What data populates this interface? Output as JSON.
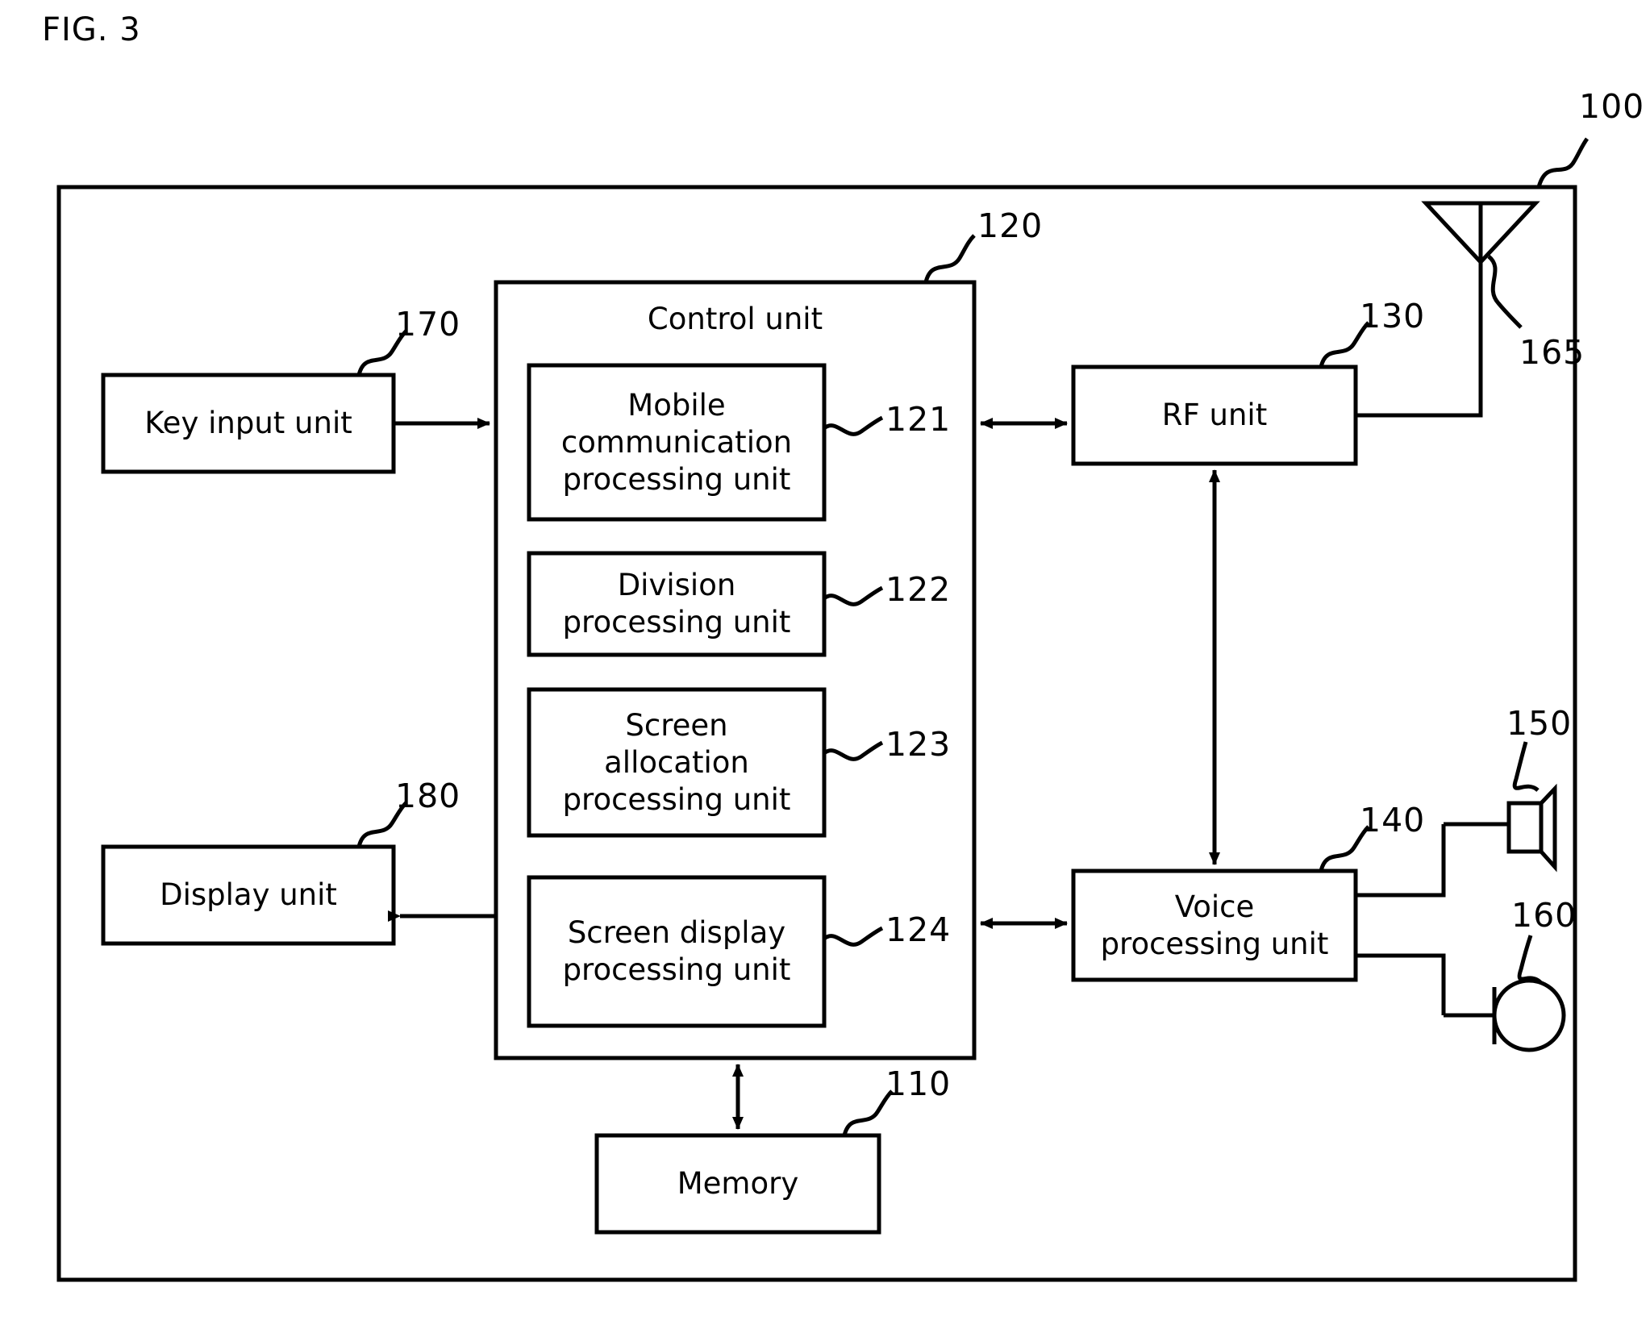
{
  "figure": {
    "title": "FIG. 3",
    "device_ref": "100"
  },
  "blocks": [
    {
      "id": "key-input-unit",
      "label": "Key input unit",
      "ref": "170"
    },
    {
      "id": "display-unit",
      "label": "Display unit",
      "ref": "180"
    },
    {
      "id": "control-unit",
      "label": "Control unit",
      "ref": "120"
    },
    {
      "id": "mobile-comm-unit",
      "label": "Mobile\ncommunication\nprocessing unit",
      "ref": "121"
    },
    {
      "id": "division-unit",
      "label": "Division\nprocessing unit",
      "ref": "122"
    },
    {
      "id": "screen-alloc-unit",
      "label": "Screen\nallocation\nprocessing unit",
      "ref": "123"
    },
    {
      "id": "screen-display-unit",
      "label": "Screen display\nprocessing unit",
      "ref": "124"
    },
    {
      "id": "rf-unit",
      "label": "RF unit",
      "ref": "130"
    },
    {
      "id": "voice-unit",
      "label": "Voice\nprocessing unit",
      "ref": "140"
    },
    {
      "id": "memory",
      "label": "Memory",
      "ref": "110"
    }
  ],
  "components": [
    {
      "id": "antenna",
      "icon": "antenna-icon",
      "ref": "165"
    },
    {
      "id": "speaker",
      "icon": "speaker-icon",
      "ref": "150"
    },
    {
      "id": "microphone",
      "icon": "microphone-icon",
      "ref": "160"
    }
  ],
  "colors": {
    "stroke": "#000000",
    "background": "#ffffff"
  }
}
